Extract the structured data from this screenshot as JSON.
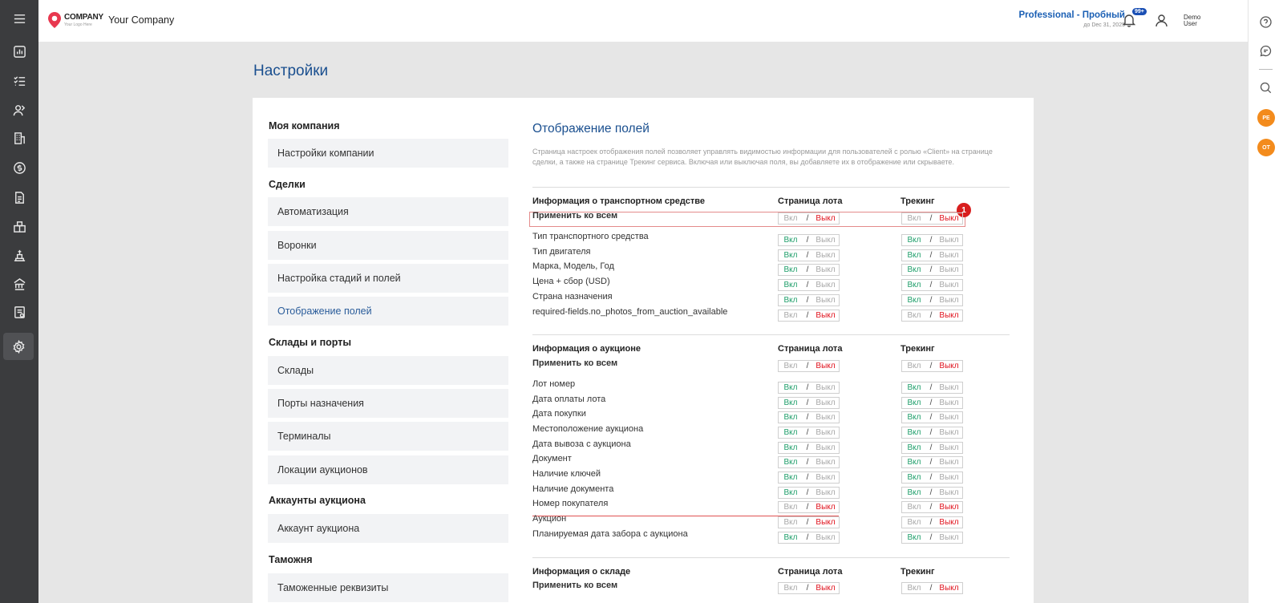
{
  "header": {
    "logo_main": "COMPANY",
    "logo_sub": "Your Logo Here",
    "company_name": "Your Company",
    "plan_name": "Professional - Пробный",
    "plan_expiry": "до Dec 31, 2025",
    "notifications_badge": "99+",
    "user_first": "Demo",
    "user_last": "User"
  },
  "rightbar": {
    "avatar1": "PE",
    "avatar2": "OT"
  },
  "page": {
    "title": "Настройки"
  },
  "nav": {
    "groups": [
      {
        "heading": "Моя компания",
        "items": [
          "Настройки компании"
        ]
      },
      {
        "heading": "Сделки",
        "items": [
          "Автоматизация",
          "Воронки",
          "Настройка стадий и полей",
          "Отображение полей"
        ]
      },
      {
        "heading": "Склады и порты",
        "items": [
          "Склады",
          "Порты назначения",
          "Терминалы",
          "Локации аукционов"
        ]
      },
      {
        "heading": "Аккаунты аукциона",
        "items": [
          "Аккаунт аукциона"
        ]
      },
      {
        "heading": "Таможня",
        "items": [
          "Таможенные реквизиты"
        ]
      }
    ]
  },
  "section": {
    "title": "Отображение полей",
    "description": "Страница настроек отображения полей позволяет управлять видимостью информации для пользователей с ролью «Client» на странице сделки, а также на странице Трекинг сервиса. Включая или выключая поля, вы добавляете их в отображение или скрываете."
  },
  "toggle": {
    "on": "Вкл",
    "sep": "/",
    "off": "Выкл"
  },
  "columns": {
    "lot": "Страница лота",
    "tracking": "Трекинг"
  },
  "groups": [
    {
      "title": "Информация о транспортном средстве",
      "apply_all": "Применить ко всем",
      "rows": [
        {
          "label": "Тип транспортного средства",
          "lot": "on",
          "tracking": "on"
        },
        {
          "label": "Тип двигателя",
          "lot": "on",
          "tracking": "on"
        },
        {
          "label": "Марка, Модель, Год",
          "lot": "on",
          "tracking": "on"
        },
        {
          "label": "Цена + сбор (USD)",
          "lot": "on",
          "tracking": "on"
        },
        {
          "label": "Страна назначения",
          "lot": "on",
          "tracking": "on"
        },
        {
          "label": "required-fields.no_photos_from_auction_available",
          "lot": "off",
          "tracking": "off"
        }
      ]
    },
    {
      "title": "Информация о аукционе",
      "apply_all": "Применить ко всем",
      "rows": [
        {
          "label": "Лот номер",
          "lot": "on",
          "tracking": "on"
        },
        {
          "label": "Дата оплаты лота",
          "lot": "on",
          "tracking": "on"
        },
        {
          "label": "Дата покупки",
          "lot": "on",
          "tracking": "on"
        },
        {
          "label": "Местоположение аукциона",
          "lot": "on",
          "tracking": "on"
        },
        {
          "label": "Дата вывоза с аукциона",
          "lot": "on",
          "tracking": "on"
        },
        {
          "label": "Документ",
          "lot": "on",
          "tracking": "on"
        },
        {
          "label": "Наличие ключей",
          "lot": "on",
          "tracking": "on"
        },
        {
          "label": "Наличие документа",
          "lot": "on",
          "tracking": "on"
        },
        {
          "label": "Номер покупателя",
          "lot": "off",
          "tracking": "off"
        },
        {
          "label": "Аукцион",
          "lot": "off",
          "tracking": "off"
        },
        {
          "label": "Планируемая дата забора с аукциона",
          "lot": "on",
          "tracking": "on"
        }
      ]
    },
    {
      "title": "Информация о складе",
      "apply_all": "Применить ко всем",
      "rows": []
    }
  ],
  "annotation": {
    "marker": "1"
  }
}
